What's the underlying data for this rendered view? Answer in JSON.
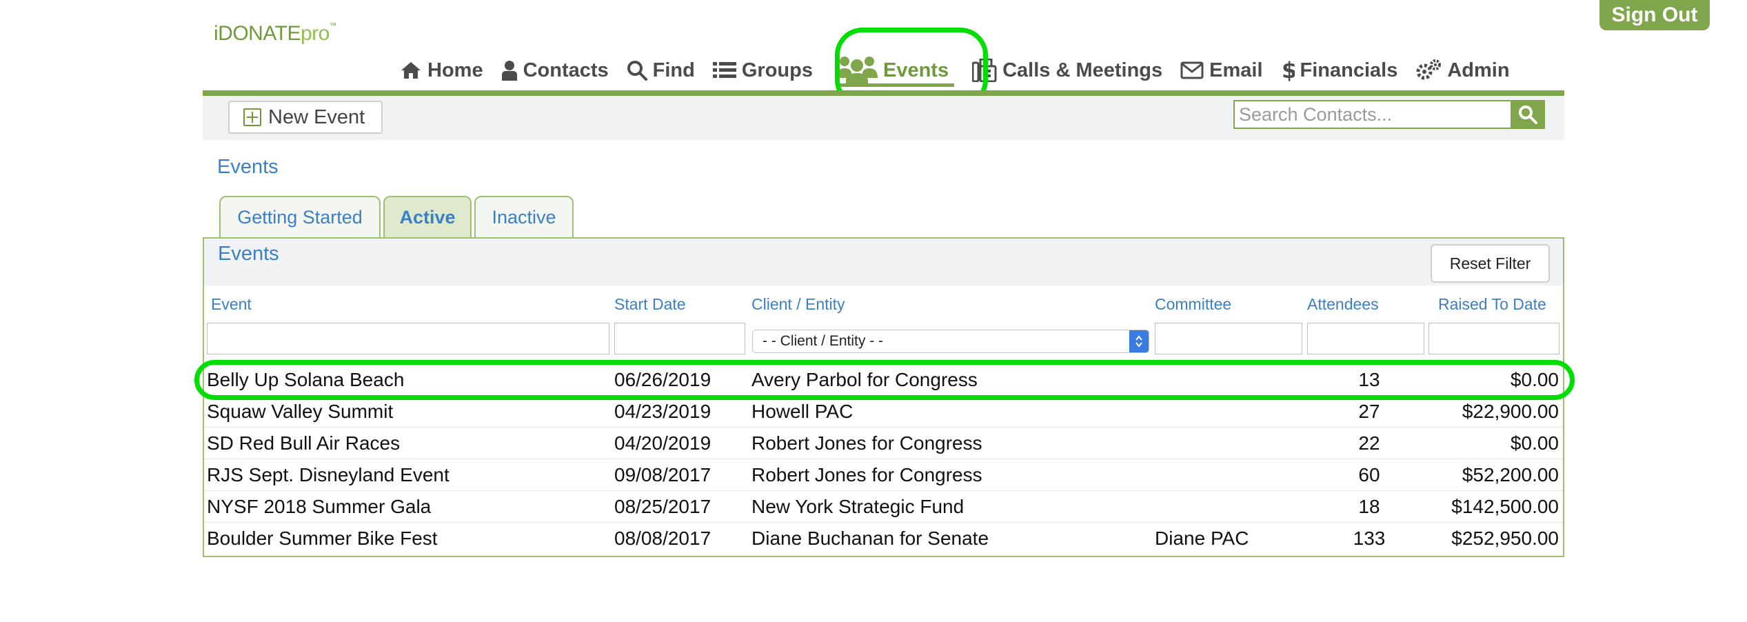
{
  "header": {
    "signout_label": "Sign Out",
    "logo": {
      "main": "iDONATE",
      "suffix": "pro",
      "tm": "™"
    }
  },
  "nav": [
    {
      "label": "Home",
      "icon": "home-icon"
    },
    {
      "label": "Contacts",
      "icon": "person-icon"
    },
    {
      "label": "Find",
      "icon": "search-icon"
    },
    {
      "label": "Groups",
      "icon": "list-icon"
    },
    {
      "label": "Events",
      "icon": "users-icon",
      "active": true
    },
    {
      "label": "Calls & Meetings",
      "icon": "phone-fax-icon"
    },
    {
      "label": "Email",
      "icon": "envelope-icon"
    },
    {
      "label": "Financials",
      "icon": "dollar-icon"
    },
    {
      "label": "Admin",
      "icon": "gears-icon"
    }
  ],
  "toolbar": {
    "new_event_label": "New Event",
    "search_placeholder": "Search Contacts..."
  },
  "page": {
    "title": "Events",
    "tabs": [
      {
        "label": "Getting Started"
      },
      {
        "label": "Active",
        "active": true
      },
      {
        "label": "Inactive"
      }
    ]
  },
  "table": {
    "title": "Events",
    "reset_label": "Reset Filter",
    "columns": [
      "Event",
      "Start Date",
      "Client / Entity",
      "Committee",
      "Attendees",
      "Raised To Date"
    ],
    "client_filter_label": "- - Client / Entity - -",
    "rows": [
      {
        "event": "Belly Up Solana Beach",
        "start": "06/26/2019",
        "client": "Avery Parbol for Congress",
        "committee": "",
        "attendees": "13",
        "raised": "$0.00"
      },
      {
        "event": "Squaw Valley Summit",
        "start": "04/23/2019",
        "client": "Howell PAC",
        "committee": "",
        "attendees": "27",
        "raised": "$22,900.00"
      },
      {
        "event": "SD Red Bull Air Races",
        "start": "04/20/2019",
        "client": "Robert Jones for Congress",
        "committee": "",
        "attendees": "22",
        "raised": "$0.00"
      },
      {
        "event": "RJS Sept. Disneyland Event",
        "start": "09/08/2017",
        "client": "Robert Jones for Congress",
        "committee": "",
        "attendees": "60",
        "raised": "$52,200.00"
      },
      {
        "event": "NYSF 2018 Summer Gala",
        "start": "08/25/2017",
        "client": "New York Strategic Fund",
        "committee": "",
        "attendees": "18",
        "raised": "$142,500.00"
      },
      {
        "event": "Boulder Summer Bike Fest",
        "start": "08/08/2017",
        "client": "Diane Buchanan for Senate",
        "committee": "Diane PAC",
        "attendees": "133",
        "raised": "$252,950.00"
      }
    ]
  },
  "colors": {
    "brand": "#7fa64a",
    "link": "#3b7fc4",
    "highlight": "#00dd00"
  }
}
